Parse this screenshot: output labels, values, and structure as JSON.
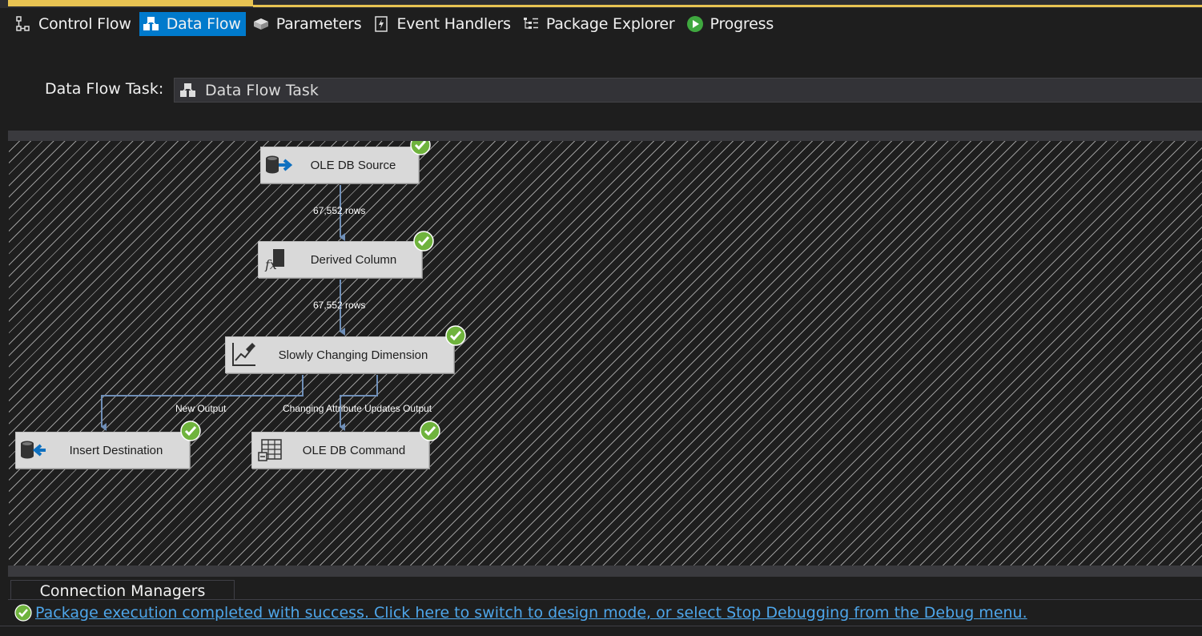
{
  "designer_tabs": [
    {
      "label": "Control Flow",
      "icon": "control-flow-icon",
      "active": false
    },
    {
      "label": "Data Flow",
      "icon": "data-flow-icon",
      "active": true
    },
    {
      "label": "Parameters",
      "icon": "parameters-icon",
      "active": false
    },
    {
      "label": "Event Handlers",
      "icon": "event-handlers-icon",
      "active": false
    },
    {
      "label": "Package Explorer",
      "icon": "package-explorer-icon",
      "active": false
    },
    {
      "label": "Progress",
      "icon": "progress-icon",
      "active": false
    }
  ],
  "task_selector": {
    "label": "Data Flow Task:",
    "value": "Data Flow Task"
  },
  "components": {
    "ole_db_source": "OLE DB Source",
    "derived_column": "Derived Column",
    "scd": "Slowly Changing Dimension",
    "insert_destination": "Insert Destination",
    "ole_db_command": "OLE DB Command"
  },
  "flows": {
    "source_to_derived_rows": "67,552 rows",
    "derived_to_scd_rows": "67,552 rows",
    "new_output": "New Output",
    "changing_output": "Changing Attribute Updates Output"
  },
  "bottom_tabs": {
    "connection_managers": "Connection Managers"
  },
  "status": {
    "message": "Package execution completed with success. Click here to switch to design mode, or select Stop Debugging from the Debug menu."
  },
  "colors": {
    "accent": "#007acc",
    "success": "#6fb33d",
    "link": "#4ea6ea",
    "document_tab": "#e8c352"
  }
}
